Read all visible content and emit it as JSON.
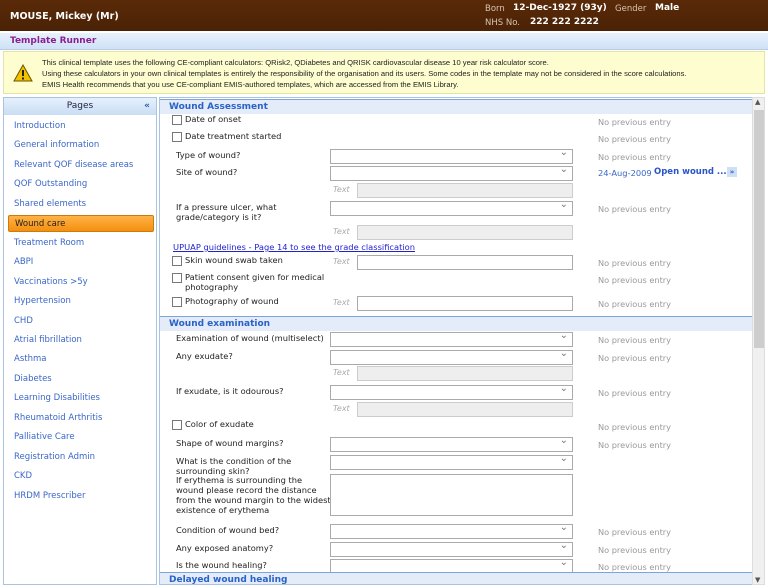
{
  "patient": {
    "name": "MOUSE, Mickey (Mr)",
    "born_label": "Born",
    "born": "12-Dec-1927 (93y)",
    "gender_label": "Gender",
    "gender": "Male",
    "nhs_label": "NHS No.",
    "nhs": "222 222 2222"
  },
  "window": {
    "title": "Template Runner"
  },
  "warning": {
    "icon": "warning-triangle-icon",
    "lines": [
      "This clinical template uses the following CE-compliant calculators: QRisk2, QDiabetes and QRISK cardiovascular disease 10 year risk calculator score.",
      "Using these calculators in your own clinical templates is entirely the responsibility of the organisation and its users.  Some codes in the template may not be considered in the score calculations.",
      "EMIS Health recommends that you use CE-compliant EMIS-authored templates, which are accessed from the EMIS Library."
    ]
  },
  "sidebar": {
    "title": "Pages",
    "collapse": "«",
    "selected": 5,
    "items": [
      "Introduction",
      "General information",
      "Relevant QOF disease areas",
      "QOF Outstanding",
      "Shared elements",
      "Wound care",
      "Treatment Room",
      "ABPI",
      "Vaccinations >5y",
      "Hypertension",
      "CHD",
      "Atrial fibrillation",
      "Asthma",
      "Diabetes",
      "Learning Disabilities",
      "Rheumatoid Arthritis",
      "Palliative Care",
      "Registration Admin",
      "CKD",
      "HRDM Prescriber"
    ]
  },
  "form": {
    "text_label": "Text",
    "rows": [
      {
        "type": "section",
        "label": "Wound Assessment"
      },
      {
        "type": "checkbox",
        "label": "Date of onset",
        "prev": "No previous entry"
      },
      {
        "type": "checkbox",
        "label": "Date treatment started",
        "prev": "No previous entry"
      },
      {
        "type": "select",
        "label": "Type of wound?",
        "prev": "No previous entry"
      },
      {
        "type": "select",
        "label": "Site of wound?",
        "prev_date": "24-Aug-2009",
        "prev_value": "Open wound ...",
        "prev_button": "»"
      },
      {
        "type": "text"
      },
      {
        "type": "select",
        "label": "If a pressure ulcer, what grade/category is it?",
        "prev": "No previous entry"
      },
      {
        "type": "text"
      },
      {
        "type": "link",
        "label": "UPUAP guidelines - Page 14 to see the grade classification"
      },
      {
        "type": "checkbox_text",
        "label": "Skin wound swab taken",
        "prev": "No previous entry"
      },
      {
        "type": "checkbox",
        "label": "Patient consent given for medical photography",
        "prev": "No previous entry"
      },
      {
        "type": "checkbox_text",
        "label": "Photography of wound",
        "prev": "No previous entry"
      },
      {
        "type": "section",
        "label": "Wound examination"
      },
      {
        "type": "select",
        "label": "Examination of wound (multiselect)",
        "prev": "No previous entry"
      },
      {
        "type": "select",
        "label": "Any exudate?",
        "prev": "No previous entry"
      },
      {
        "type": "text"
      },
      {
        "type": "select",
        "label": "If exudate, is it odourous?",
        "prev": "No previous entry"
      },
      {
        "type": "text"
      },
      {
        "type": "checkbox",
        "label": "Color of exudate",
        "prev": "No previous entry"
      },
      {
        "type": "select",
        "label": "Shape of wound margins?",
        "prev": "No previous entry"
      },
      {
        "type": "select",
        "label": "What is the condition of the surrounding skin?"
      },
      {
        "type": "textarea",
        "label": "If erythema is surrounding the wound please record the distance from the wound margin to the widest existence of erythema"
      },
      {
        "type": "select",
        "label": "Condition of wound bed?",
        "prev": "No previous entry"
      },
      {
        "type": "select",
        "label": "Any exposed anatomy?",
        "prev": "No previous entry"
      },
      {
        "type": "select",
        "label": "Is the wound healing?",
        "prev": "No previous entry"
      },
      {
        "type": "section",
        "label": "Delayed wound healing"
      }
    ]
  }
}
